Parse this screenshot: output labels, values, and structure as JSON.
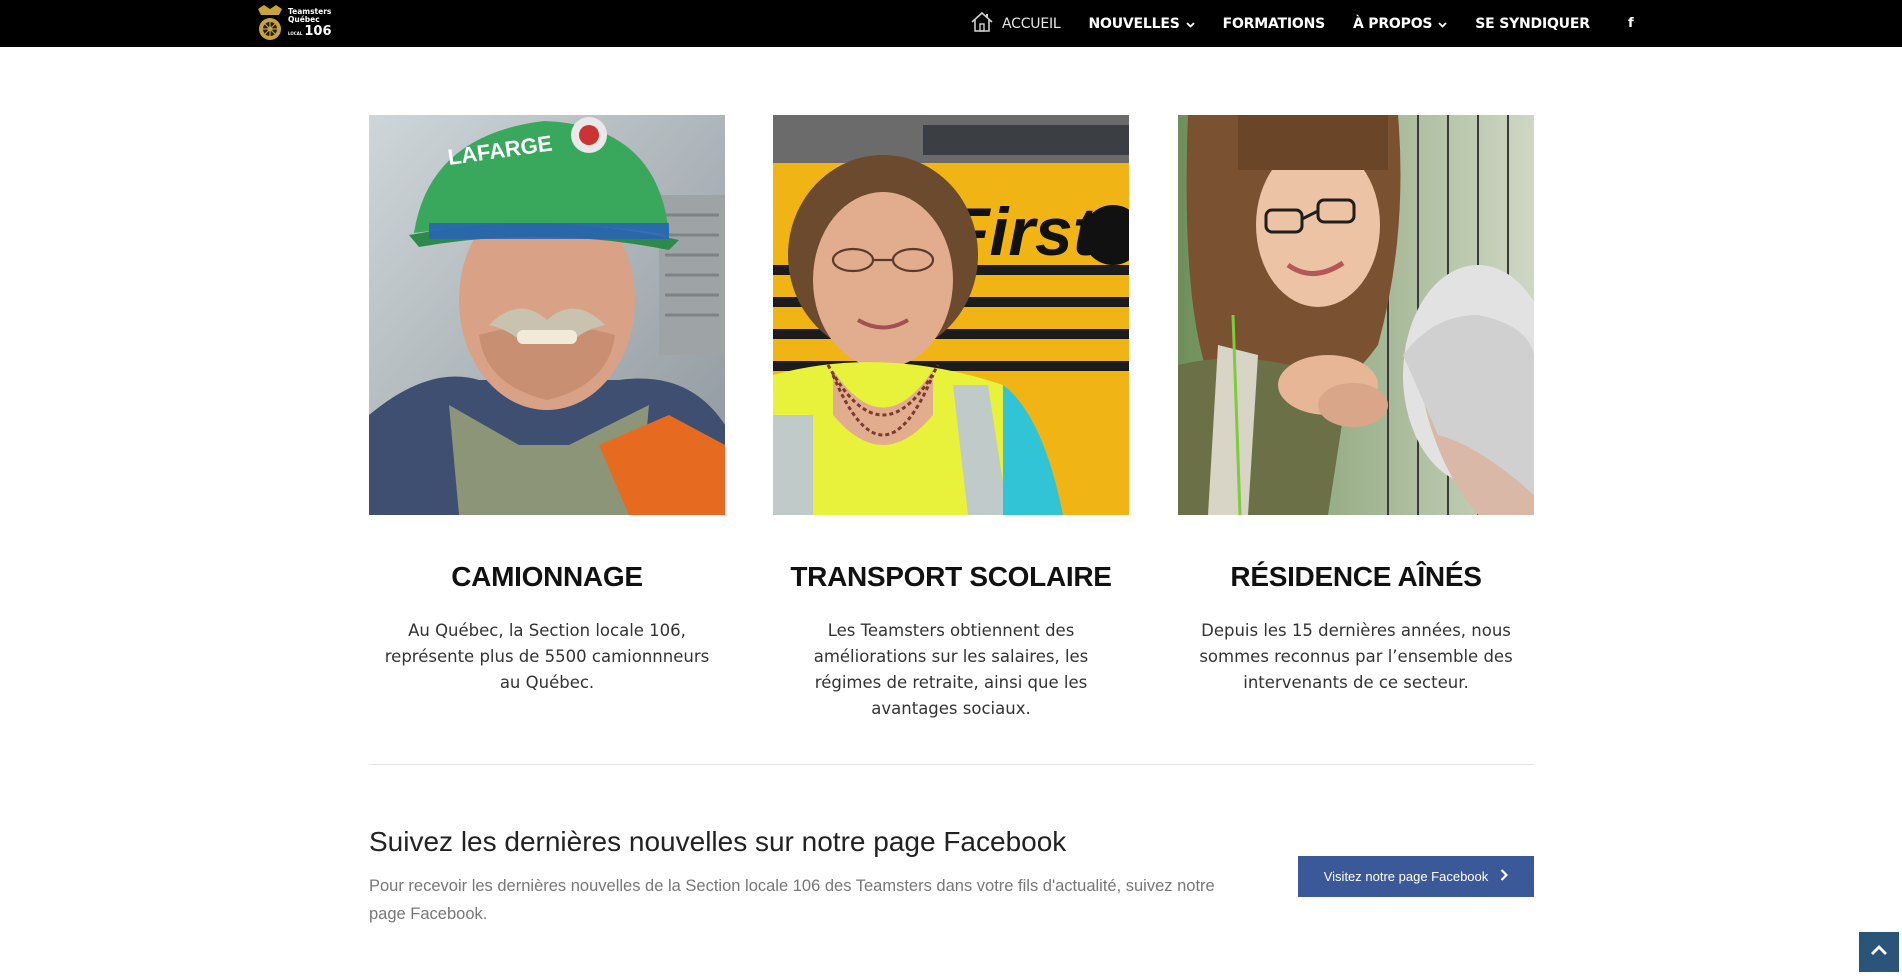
{
  "header": {
    "logo": {
      "line1": "Teamsters",
      "line2": "Québec",
      "line3_small": "LOCAL",
      "line3_num": "106"
    },
    "nav": [
      {
        "label": "ACCUEIL"
      },
      {
        "label": "NOUVELLES"
      },
      {
        "label": "FORMATIONS"
      },
      {
        "label": "À PROPOS"
      },
      {
        "label": "SE SYNDIQUER"
      }
    ],
    "facebook_glyph": "f"
  },
  "cards": [
    {
      "title": "CAMIONNAGE",
      "text": "Au Québec, la Section locale 106, représente plus de 5500 camionnneurs au Québec.",
      "image_lettering": "LAFARGE"
    },
    {
      "title": "TRANSPORT SCOLAIRE",
      "text": "Les Teamsters obtiennent des améliorations sur les salaires, les régimes de retraite, ainsi que les avantages sociaux.",
      "image_lettering": "First"
    },
    {
      "title": "RÉSIDENCE AÎNÉS",
      "text": "Depuis les 15 dernières années, nous sommes reconnus par l’ensemble des intervenants de ce secteur."
    }
  ],
  "facebook_section": {
    "title": "Suivez les dernières nouvelles sur notre page Facebook",
    "description": "Pour recevoir les dernières nouvelles de la Section locale 106 des Teamsters dans votre fils d'actualité, suivez notre page Facebook.",
    "button_label": "Visitez notre page Facebook"
  },
  "colors": {
    "header_bg": "#000000",
    "facebook_blue": "#3b5998",
    "back_to_top": "#2a5479"
  }
}
